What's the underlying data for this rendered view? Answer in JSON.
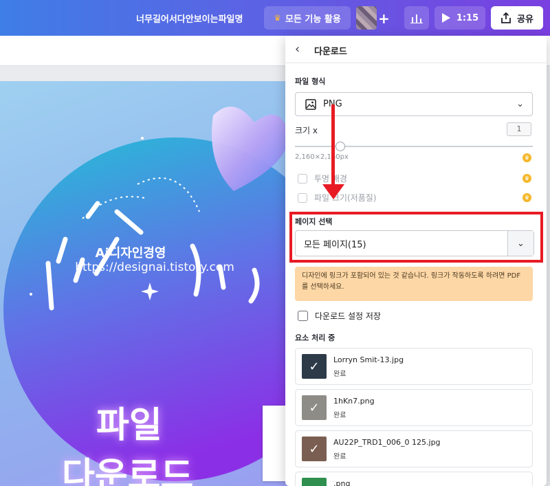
{
  "topbar": {
    "file_title": "너무길어서다안보이는파일명",
    "features_label": "모든 기능 활용",
    "play_time": "1:15",
    "share_label": "공유",
    "plus": "+"
  },
  "design": {
    "watermark_line1": "Ai디자인경영",
    "watermark_line2": "https://designai.tistory.com",
    "big_line1": "파일",
    "big_line2": "다운로드"
  },
  "panel": {
    "title": "다운로드",
    "file_format_label": "파일 형식",
    "file_format_value": "PNG",
    "size_label": "크기 x",
    "size_value": "1",
    "dimensions": "2,160×2,160px",
    "transparent_bg": "투명 배경",
    "compress_file": "파일 크기(저품질)",
    "page_select_label": "페이지 선택",
    "page_select_value": "모든 페이지(15)",
    "notice": "디자인에 링크가 포함되어 있는 것 같습니다. 링크가 작동하도록 하려면 PDF를 선택하세요.",
    "save_settings": "다운로드 설정 저장",
    "processing_label": "요소 처리 중",
    "files": [
      {
        "name": "Lorryn Smit-13.jpg",
        "status": "완료",
        "thumb_color": "#2d3a48"
      },
      {
        "name": "1hKn7.png",
        "status": "완료",
        "thumb_color": "#8e8c87"
      },
      {
        "name": "AU22P_TRD1_006_0 125.jpg",
        "status": "완료",
        "thumb_color": "#7b5e52"
      },
      {
        "name": ".png",
        "status": "",
        "thumb_color": "#2f8f4e"
      }
    ]
  },
  "colors": {
    "accent_red": "#e81b24",
    "notice_bg": "#fdd7a6",
    "crown": "#f4b82c"
  }
}
